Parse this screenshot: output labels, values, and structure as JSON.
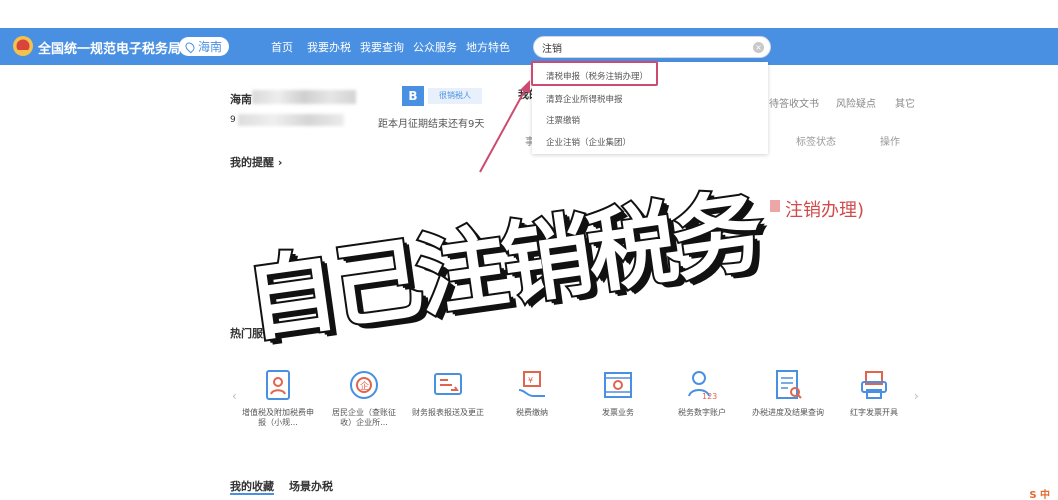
{
  "header": {
    "site_title": "全国统一规范电子税务局",
    "region": "海南",
    "nav": [
      "首页",
      "我要办税",
      "我要查询",
      "公众服务",
      "地方特色"
    ],
    "search_value": "注销"
  },
  "dropdown": {
    "items": [
      "清税申报（税务注销办理）",
      "清算企业所得税申报",
      "注票缴销",
      "企业注销（企业集团）"
    ]
  },
  "user": {
    "name_prefix": "海南",
    "id_prefix": "9",
    "badge_letter": "B",
    "taxpayer_tag": "很销税人",
    "deadline": "距本月征期结束还有9天"
  },
  "panel": {
    "tab_title": "我的",
    "links": [
      "待答收文书",
      "风险疑点",
      "其它"
    ],
    "side_label": "事项",
    "columns": [
      "标签状态",
      "操作"
    ]
  },
  "reminder": "我的提醒 ›",
  "ghost_text": "注销办理)",
  "overlay_text": "自己注销税务",
  "hot": {
    "title": "热门服务",
    "services": [
      {
        "label": "增值税及附加税费申报（小规...",
        "icon": "person-doc-icon"
      },
      {
        "label": "居民企业（查账征收）企业所...",
        "icon": "enterprise-icon"
      },
      {
        "label": "财务报表报送及更正",
        "icon": "report-icon"
      },
      {
        "label": "税费缴纳",
        "icon": "tax-pay-icon"
      },
      {
        "label": "发票业务",
        "icon": "invoice-icon"
      },
      {
        "label": "税务数字账户",
        "icon": "digital-account-icon"
      },
      {
        "label": "办税进度及结果查询",
        "icon": "progress-query-icon"
      },
      {
        "label": "红字发票开具",
        "icon": "red-invoice-icon"
      }
    ]
  },
  "bottom_tabs": [
    "我的收藏",
    "场景办税"
  ],
  "corner_badge": "S 中",
  "colors": {
    "primary": "#4a90e2",
    "highlight": "#cd4b70"
  }
}
